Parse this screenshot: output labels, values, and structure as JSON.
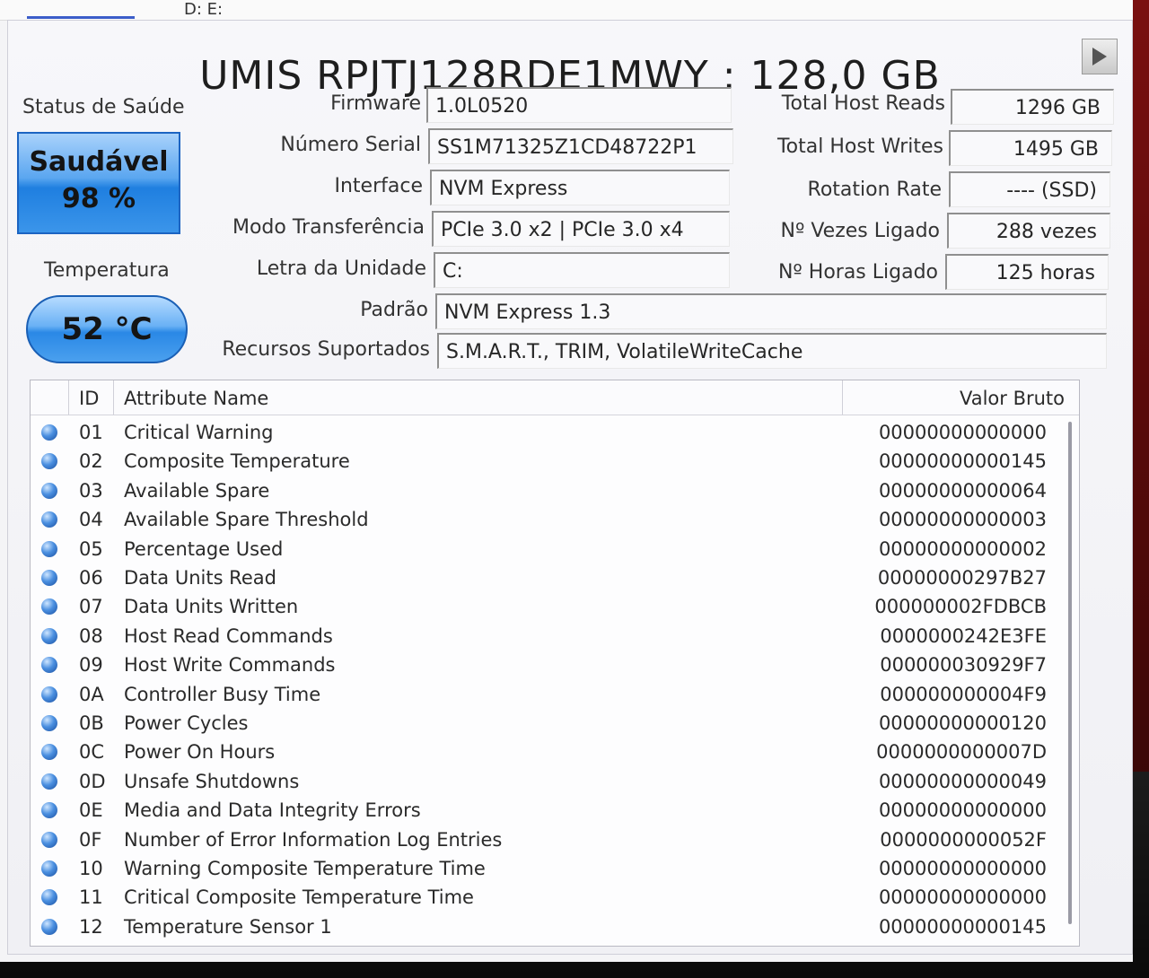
{
  "top": {
    "drive_letters": "D: E:"
  },
  "title": "UMIS RPJTJ128RDE1MWY : 128,0 GB",
  "health": {
    "label": "Status de Saúde",
    "status": "Saudável",
    "percent": "98 %"
  },
  "temperature": {
    "label": "Temperatura",
    "value": "52 °C"
  },
  "info_left": [
    {
      "label": "Firmware",
      "value": "1.0L0520"
    },
    {
      "label": "Número Serial",
      "value": "SS1M71325Z1CD48722P1"
    },
    {
      "label": "Interface",
      "value": "NVM Express"
    },
    {
      "label": "Modo Transferência",
      "value": "PCIe 3.0 x2 | PCIe 3.0 x4"
    },
    {
      "label": "Letra da Unidade",
      "value": "C:"
    },
    {
      "label": "Padrão",
      "value": "NVM Express 1.3"
    },
    {
      "label": "Recursos Suportados",
      "value": "S.M.A.R.T., TRIM, VolatileWriteCache"
    }
  ],
  "info_right": [
    {
      "label": "Total Host Reads",
      "value": "1296 GB"
    },
    {
      "label": "Total Host Writes",
      "value": "1495 GB"
    },
    {
      "label": "Rotation Rate",
      "value": "---- (SSD)"
    },
    {
      "label": "Nº Vezes Ligado",
      "value": "288 vezes"
    },
    {
      "label": "Nº Horas Ligado",
      "value": "125 horas"
    }
  ],
  "table": {
    "headers": {
      "id": "ID",
      "name": "Attribute Name",
      "raw": "Valor Bruto"
    },
    "rows": [
      {
        "id": "01",
        "name": "Critical Warning",
        "raw": "00000000000000"
      },
      {
        "id": "02",
        "name": "Composite Temperature",
        "raw": "00000000000145"
      },
      {
        "id": "03",
        "name": "Available Spare",
        "raw": "00000000000064"
      },
      {
        "id": "04",
        "name": "Available Spare Threshold",
        "raw": "00000000000003"
      },
      {
        "id": "05",
        "name": "Percentage Used",
        "raw": "00000000000002"
      },
      {
        "id": "06",
        "name": "Data Units Read",
        "raw": "00000000297B27"
      },
      {
        "id": "07",
        "name": "Data Units Written",
        "raw": "000000002FDBCB"
      },
      {
        "id": "08",
        "name": "Host Read Commands",
        "raw": "0000000242E3FE"
      },
      {
        "id": "09",
        "name": "Host Write Commands",
        "raw": "000000030929F7"
      },
      {
        "id": "0A",
        "name": "Controller Busy Time",
        "raw": "000000000004F9"
      },
      {
        "id": "0B",
        "name": "Power Cycles",
        "raw": "00000000000120"
      },
      {
        "id": "0C",
        "name": "Power On Hours",
        "raw": "0000000000007D"
      },
      {
        "id": "0D",
        "name": "Unsafe Shutdowns",
        "raw": "00000000000049"
      },
      {
        "id": "0E",
        "name": "Media and Data Integrity Errors",
        "raw": "00000000000000"
      },
      {
        "id": "0F",
        "name": "Number of Error Information Log Entries",
        "raw": "0000000000052F"
      },
      {
        "id": "10",
        "name": "Warning Composite Temperature Time",
        "raw": "00000000000000"
      },
      {
        "id": "11",
        "name": "Critical Composite Temperature Time",
        "raw": "00000000000000"
      },
      {
        "id": "12",
        "name": "Temperature Sensor 1",
        "raw": "00000000000145"
      }
    ]
  },
  "colors": {
    "health_blue": "#3b95ea",
    "status_dot": "#4a8fe0"
  },
  "icons": {
    "next_disk": "play-icon",
    "status_dot": "status-dot-icon"
  }
}
